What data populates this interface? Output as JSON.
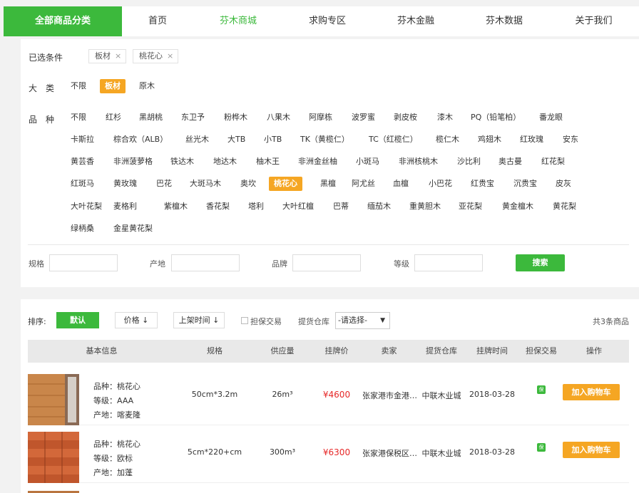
{
  "nav": {
    "all_categories": "全部商品分类",
    "items": [
      "首页",
      "芬木商城",
      "求购专区",
      "芬木金融",
      "芬木数据",
      "关于我们"
    ],
    "active_index": 1
  },
  "filter": {
    "selected_label": "已选条件",
    "selected_tags": [
      "板材",
      "桃花心"
    ],
    "category_label": "大　类",
    "categories": [
      "不限",
      "板材",
      "原木"
    ],
    "category_selected": "板材",
    "species_label": "品　种",
    "species_rows": [
      [
        "不限",
        "红杉",
        "黑胡桃",
        "东卫予",
        "粉桦木",
        "八果木",
        "阿摩栋",
        "波罗蜜",
        "剥皮桉",
        "漆木",
        "PQ（铅笔柏）",
        "番龙眼"
      ],
      [
        "卡斯拉",
        "棕合欢（ALB）",
        "丝光木",
        "大TB",
        "小TB",
        "TK（黄榄仁）",
        "TC（红榄仁）",
        "榄仁木",
        "鸡翅木",
        "红玫瑰",
        "安东"
      ],
      [
        "黄芸香",
        "非洲菠萝格",
        "铁达木",
        "地达木",
        "柚木王",
        "非洲金丝柚",
        "小斑马",
        "非洲核桃木",
        "沙比利",
        "奥古曼",
        "红花梨"
      ],
      [
        "红斑马",
        "黄玫瑰",
        "巴花",
        "大斑马木",
        "奥坎",
        "桃花心",
        "黑檀",
        "阿尤丝",
        "血檀",
        "小巴花",
        "红贵宝",
        "沉贵宝",
        "皮灰"
      ],
      [
        "大叶花梨",
        "麦格利",
        "紫檀木",
        "香花梨",
        "塔利",
        "大叶红檀",
        "巴蒂",
        "缅茄木",
        "重黄胆木",
        "亚花梨",
        "黄金檀木",
        "黄花梨"
      ],
      [
        "绿柄桑",
        "金星黄花梨"
      ]
    ],
    "species_selected": "桃花心",
    "search": {
      "spec_label": "规格",
      "origin_label": "产地",
      "brand_label": "品牌",
      "grade_label": "等级",
      "button": "搜索"
    }
  },
  "list": {
    "sort_label": "排序:",
    "sort_default": "默认",
    "sort_price": "价格",
    "sort_time": "上架时间",
    "guarantee_label": "担保交易",
    "warehouse_label": "提货仓库",
    "warehouse_value": "-请选择-",
    "total": "共3条商品",
    "headers": [
      "基本信息",
      "规格",
      "供应量",
      "挂牌价",
      "卖家",
      "提货仓库",
      "挂牌时间",
      "担保交易",
      "操作"
    ],
    "rows": [
      {
        "species": "品种：桃花心",
        "grade": "等级：AAA",
        "origin": "产地：喀麦隆",
        "spec": "50cm*3.2m",
        "supply": "26m³",
        "price": "¥4600",
        "seller": "张家港市金港…",
        "warehouse": "中联木业城",
        "date": "2018-03-28",
        "badge": "保",
        "action": "加入购物车"
      },
      {
        "species": "品种：桃花心",
        "grade": "等级：欧标",
        "origin": "产地：加蓬",
        "spec": "5cm*220+cm",
        "supply": "300m³",
        "price": "¥6300",
        "seller": "张家港保税区…",
        "warehouse": "中联木业城",
        "date": "2018-03-28",
        "badge": "保",
        "action": "加入购物车"
      }
    ]
  },
  "colors": {
    "accent": "#3cb93c",
    "orange": "#f5a623",
    "price": "#e62828"
  }
}
